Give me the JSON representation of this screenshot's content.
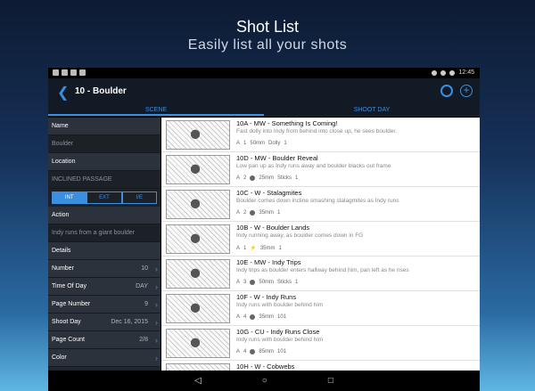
{
  "promo": {
    "title": "Shot List",
    "subtitle": "Easily list all your shots"
  },
  "status": {
    "time": "12:45"
  },
  "appbar": {
    "title": "10 - Boulder",
    "back_icon": "chevron-left-icon",
    "settings_icon": "gear-icon",
    "add_icon": "plus-icon"
  },
  "tabs": [
    {
      "label": "SCENE"
    },
    {
      "label": "SHOOT DAY"
    }
  ],
  "left": {
    "name_label": "Name",
    "name_value": "Boulder",
    "location_label": "Location",
    "location_value": "INCLINED PASSAGE",
    "seg": [
      "INT",
      "EXT",
      "I/E"
    ],
    "action_label": "Action",
    "action_value": "Indy runs from a giant boulder",
    "details_label": "Details",
    "rows": [
      {
        "label": "Number",
        "value": "10"
      },
      {
        "label": "Time Of Day",
        "value": "DAY"
      },
      {
        "label": "Page Number",
        "value": "9"
      },
      {
        "label": "Shoot Day",
        "value": "Dec 16, 2015"
      },
      {
        "label": "Page Count",
        "value": "2/8"
      },
      {
        "label": "Color",
        "value": ""
      }
    ]
  },
  "shots": [
    {
      "title": "10A - MW - Something Is Coming!",
      "desc": "Fast dolly into Indy from behind into close up, he sees boulder.",
      "meta": [
        "A",
        "1",
        "50mm",
        "Dolly",
        "1"
      ]
    },
    {
      "title": "10D - MW - Boulder Reveal",
      "desc": "Low pan up as Indy runs away and boulder blacks out frame",
      "meta": [
        "A",
        "2",
        "25mm",
        "Sticks",
        "1"
      ]
    },
    {
      "title": "10C - W - Stalagmites",
      "desc": "Boulder comes down incline smashing stalagmites as Indy runs",
      "meta": [
        "A",
        "2",
        "35mm",
        "1"
      ]
    },
    {
      "title": "10B - W - Boulder Lands",
      "desc": "Indy running away, as boulder comes down in FG",
      "meta": [
        "A",
        "1",
        "35mm",
        "1"
      ]
    },
    {
      "title": "10E - MW - Indy Trips",
      "desc": "Indy trips as boulder enters hallway behind him, pan left as he rises",
      "meta": [
        "A",
        "3",
        "50mm",
        "Sticks",
        "1"
      ]
    },
    {
      "title": "10F - W - Indy Runs",
      "desc": "Indy runs with boulder behind him",
      "meta": [
        "A",
        "4",
        "35mm",
        "101"
      ]
    },
    {
      "title": "10G - CU - Indy Runs Close",
      "desc": "Indy runs with boulder behind him",
      "meta": [
        "A",
        "4",
        "85mm",
        "101"
      ]
    },
    {
      "title": "10H - W - Cobwebs",
      "desc": "",
      "meta": []
    }
  ],
  "nav": [
    "back",
    "home",
    "recents"
  ]
}
